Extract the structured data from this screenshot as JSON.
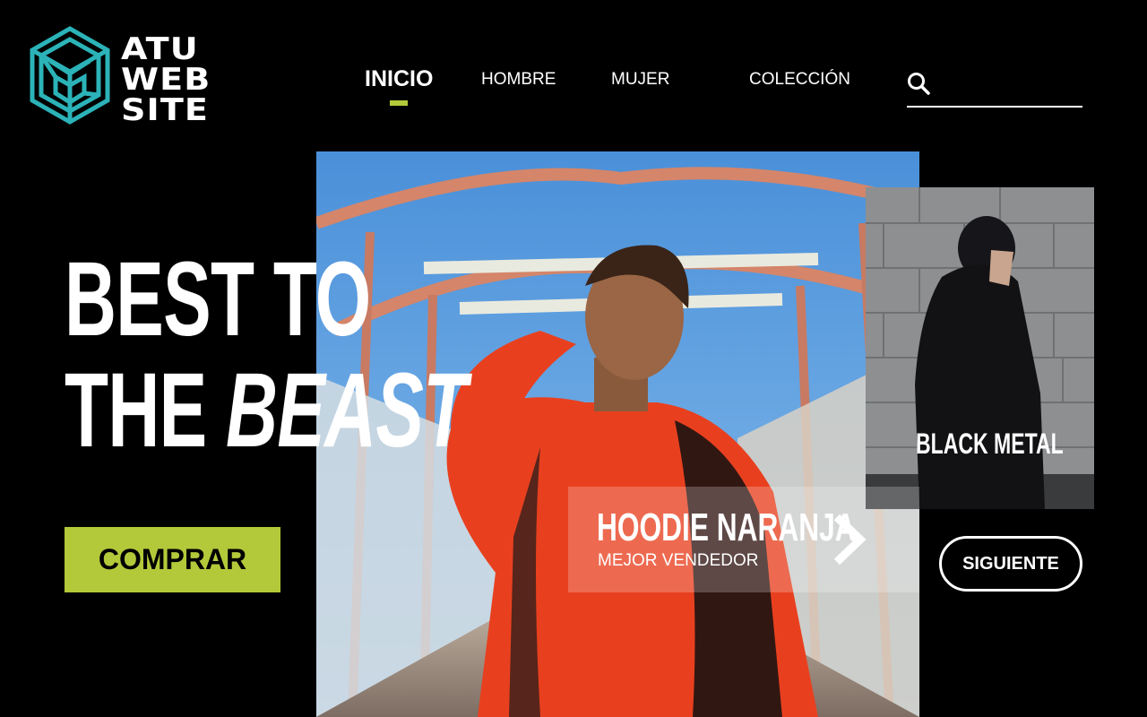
{
  "brand": {
    "logo_lines": [
      "ATU",
      "WEB",
      "SITE"
    ],
    "logo_icon": "impossible-cube-icon",
    "accent_color": "#b3c93a",
    "logo_color": "#2bb3b8"
  },
  "nav": {
    "items": [
      {
        "label": "INICIO",
        "active": true
      },
      {
        "label": "HOMBRE",
        "active": false
      },
      {
        "label": "MUJER",
        "active": false
      },
      {
        "label": "COLECCIÓN",
        "active": false
      }
    ]
  },
  "search": {
    "icon": "search-icon",
    "value": ""
  },
  "hero": {
    "headline_line1": "BEST TO",
    "headline_line2_plain": "THE",
    "headline_line2_emphasis": "BEAST",
    "cta_label": "COMPRAR"
  },
  "featured_product": {
    "name": "HOODIE NARANJA",
    "subtitle": "MEJOR VENDEDOR",
    "next_icon": "chevron-right-icon"
  },
  "side_card": {
    "label": "BLACK METAL"
  },
  "next_button": {
    "label": "SIGUIENTE"
  }
}
